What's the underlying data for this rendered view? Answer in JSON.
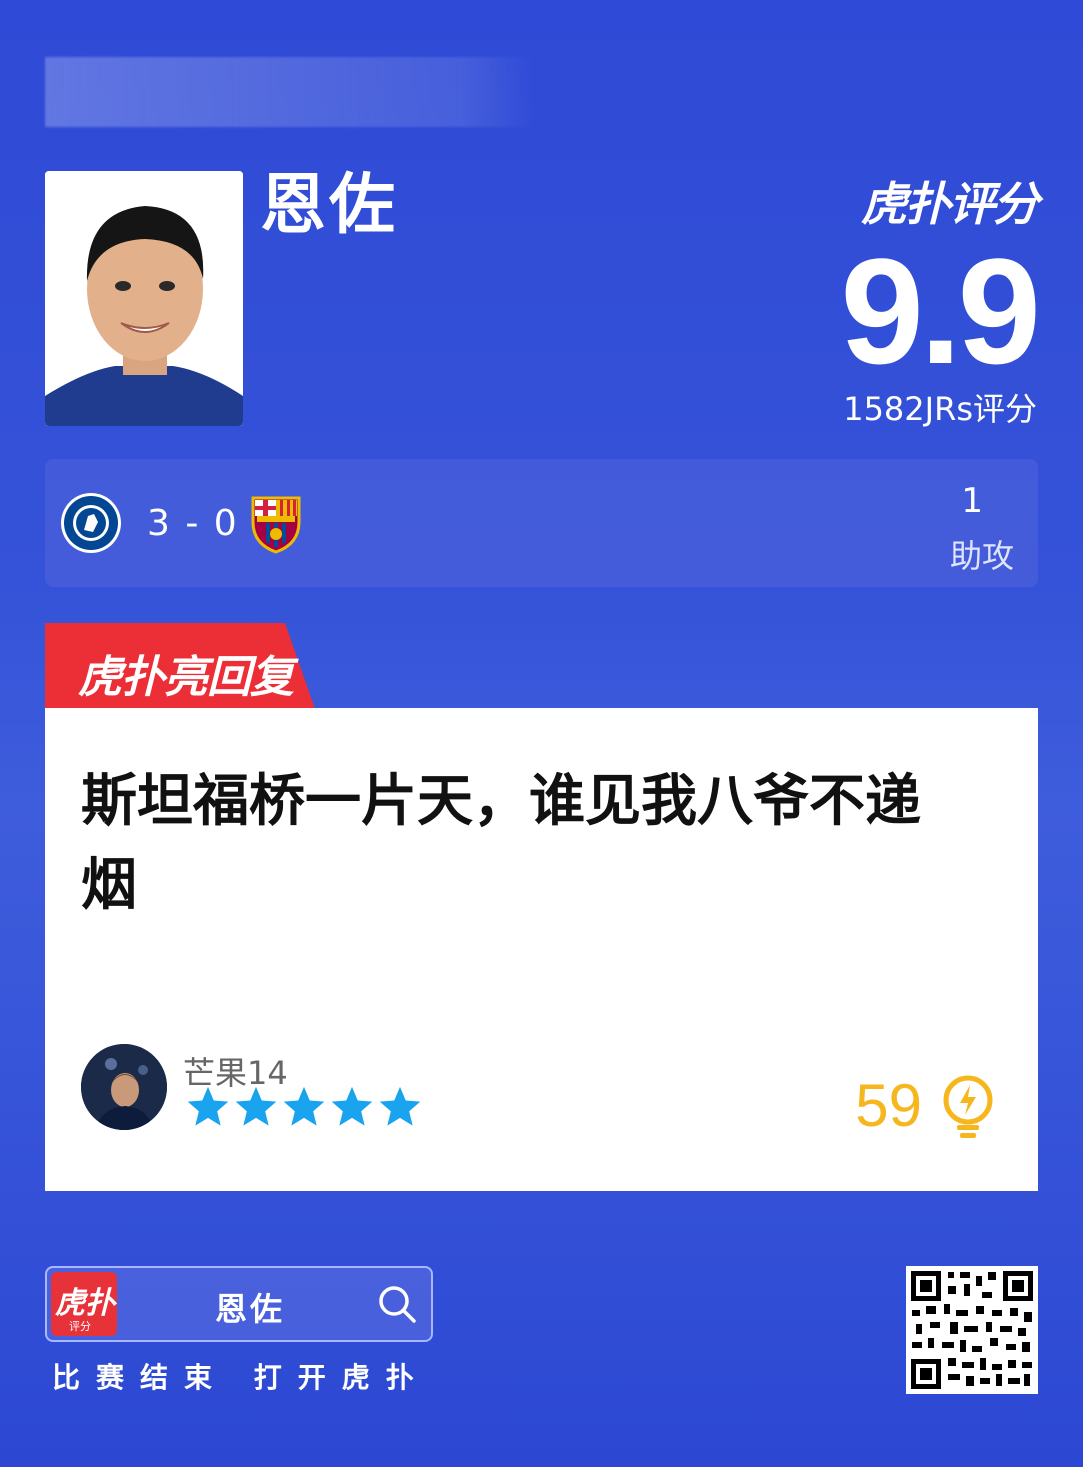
{
  "header": {
    "player_name": "恩佐"
  },
  "rating": {
    "logo_text": "虎扑评分",
    "score": "9.9",
    "count_text": "1582JRs评分"
  },
  "match": {
    "score": "3 - 0",
    "stat_value": "1",
    "stat_label": "助攻"
  },
  "reply": {
    "tab_label": "虎扑亮回复",
    "text": "斯坦福桥一片天，谁见我八爷不递烟",
    "username": "芒果14",
    "stars": 5,
    "likes": "59"
  },
  "footer": {
    "app_icon_text": "虎扑",
    "app_icon_sub": "评分",
    "search_text": "恩佐",
    "slogan": "比赛结束 打开虎扑"
  },
  "colors": {
    "background": "#2f4ad6",
    "accent_red": "#e8323a",
    "star_blue": "#1aa3ef",
    "likes_yellow": "#f6b61d"
  }
}
